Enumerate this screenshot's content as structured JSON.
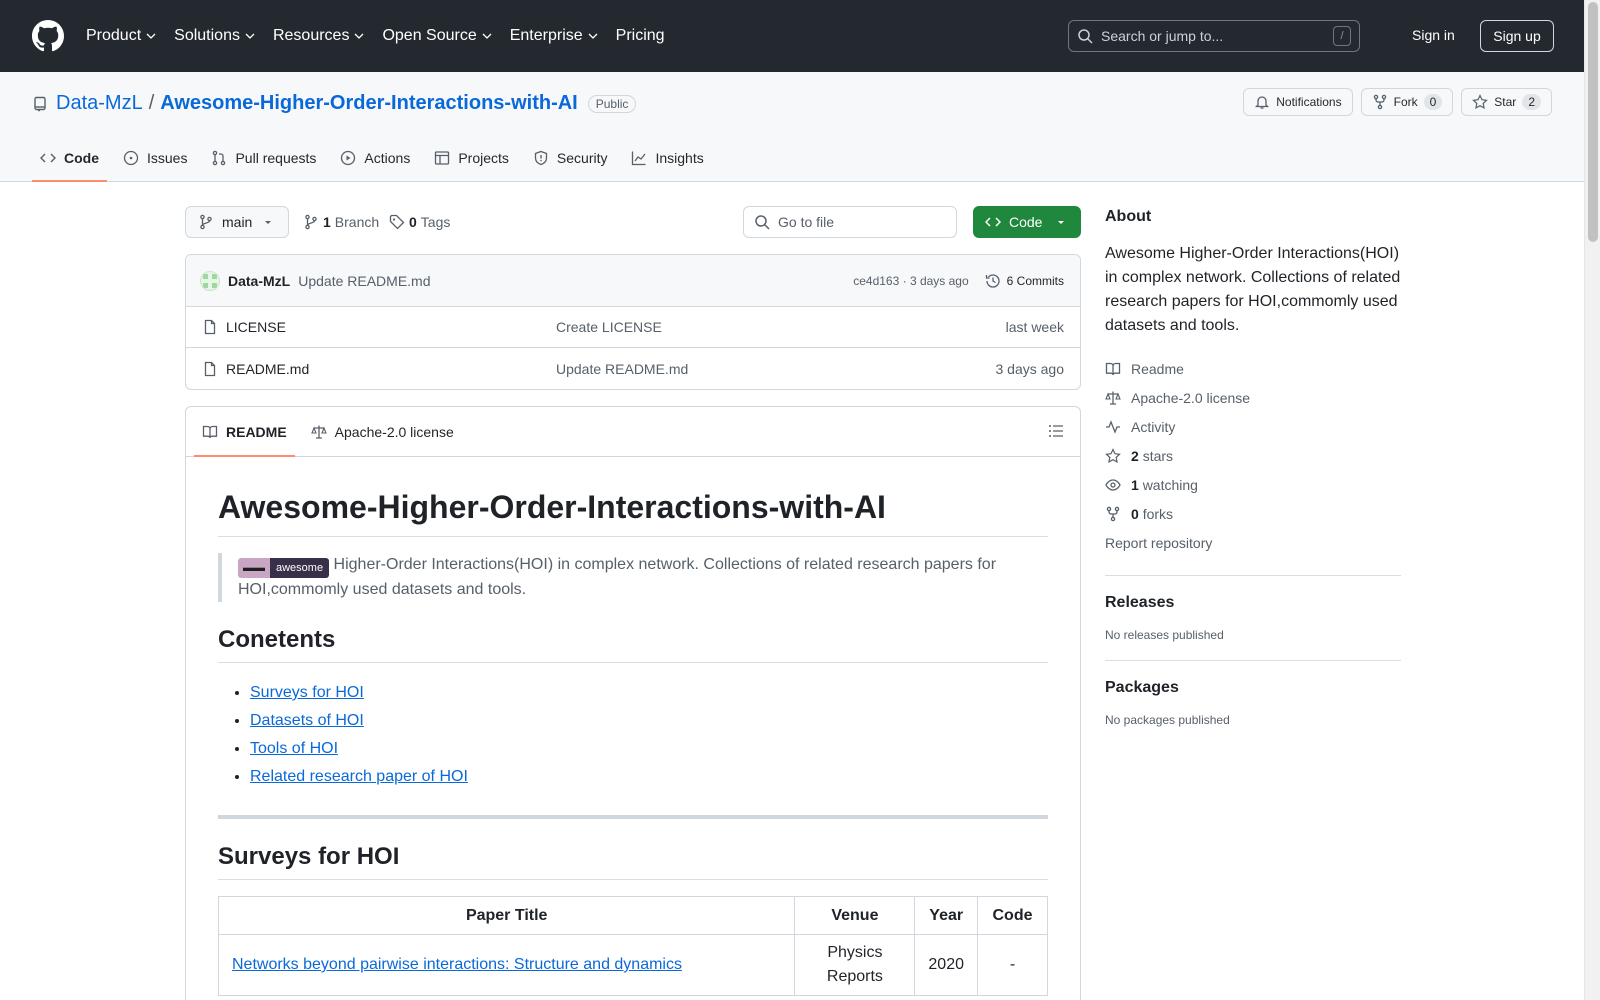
{
  "header": {
    "nav": [
      "Product",
      "Solutions",
      "Resources",
      "Open Source",
      "Enterprise",
      "Pricing"
    ],
    "search_placeholder": "Search or jump to...",
    "search_shortcut": "/",
    "sign_in": "Sign in",
    "sign_up": "Sign up"
  },
  "repo": {
    "owner": "Data-MzL",
    "separator": "/",
    "name": "Awesome-Higher-Order-Interactions-with-AI",
    "visibility": "Public",
    "notifications_label": "Notifications",
    "fork_label": "Fork",
    "fork_count": "0",
    "star_label": "Star",
    "star_count": "2",
    "tabs": [
      "Code",
      "Issues",
      "Pull requests",
      "Actions",
      "Projects",
      "Security",
      "Insights"
    ]
  },
  "toolbar": {
    "branch": "main",
    "branch_count": "1",
    "branch_label": "Branch",
    "tag_count": "0",
    "tag_label": "Tags",
    "goto_placeholder": "Go to file",
    "code_button": "Code"
  },
  "commit": {
    "author": "Data-MzL",
    "message": "Update README.md",
    "meta": "ce4d163 · 3 days ago",
    "commits_label": "6 Commits"
  },
  "files": [
    {
      "name": "LICENSE",
      "message": "Create LICENSE",
      "date": "last week"
    },
    {
      "name": "README.md",
      "message": "Update README.md",
      "date": "3 days ago"
    }
  ],
  "readme": {
    "tab_readme": "README",
    "tab_license": "Apache-2.0 license",
    "title": "Awesome-Higher-Order-Interactions-with-AI",
    "badge_text": "awesome",
    "intro": "Higher-Order Interactions(HOI) in complex network. Collections of related research papers for HOI,commomly used datasets and tools.",
    "contents_heading": "Conetents",
    "contents": [
      "Surveys for HOI",
      "Datasets of HOI",
      "Tools of HOI",
      "Related research paper of HOI"
    ],
    "surveys_heading": "Surveys for HOI",
    "table_headers": [
      "Paper Title",
      "Venue",
      "Year",
      "Code"
    ],
    "table_rows": [
      {
        "title": "Networks beyond pairwise interactions: Structure and dynamics",
        "venue": "Physics Reports",
        "year": "2020",
        "code": "-"
      }
    ]
  },
  "sidebar": {
    "about_heading": "About",
    "about_text": "Awesome Higher-Order Interactions(HOI) in complex network. Collections of related research papers for HOI,commomly used datasets and tools.",
    "readme": "Readme",
    "license": "Apache-2.0 license",
    "activity": "Activity",
    "stars_count": "2",
    "stars_label": "stars",
    "watching_count": "1",
    "watching_label": "watching",
    "forks_count": "0",
    "forks_label": "forks",
    "report": "Report repository",
    "releases_heading": "Releases",
    "releases_text": "No releases published",
    "packages_heading": "Packages",
    "packages_text": "No packages published"
  },
  "colors": {
    "header_bg": "#24292f",
    "link": "#0969da",
    "primary_button": "#1f883d",
    "tab_underline": "#fd8c73"
  }
}
